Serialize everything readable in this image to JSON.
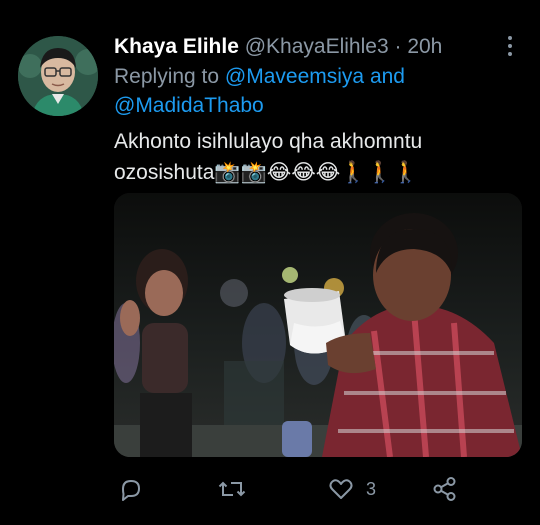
{
  "tweet": {
    "display_name": "Khaya Elihle",
    "handle": "@KhayaElihle3",
    "separator": "·",
    "time": "20h",
    "replying_to_label": "Replying to",
    "mention_1": "@Maveemsiya",
    "and_label": "and",
    "mention_2": "@MadidaThabo",
    "text": "Akhonto isihlulayo qha akhomntu\nozosishuta📸📸😂😂😂🚶🚶🚶",
    "media_alt": "photo-of-man-drinking-from-cup-with-woman-in-background",
    "like_count": "3"
  },
  "icons": {
    "more": "more-vertical-icon",
    "reply": "reply-icon",
    "retweet": "retweet-icon",
    "like": "heart-icon",
    "share": "share-icon"
  },
  "colors": {
    "background": "#000000",
    "text": "#e7e9ea",
    "muted": "#8b98a5",
    "link": "#1d9bf0"
  }
}
